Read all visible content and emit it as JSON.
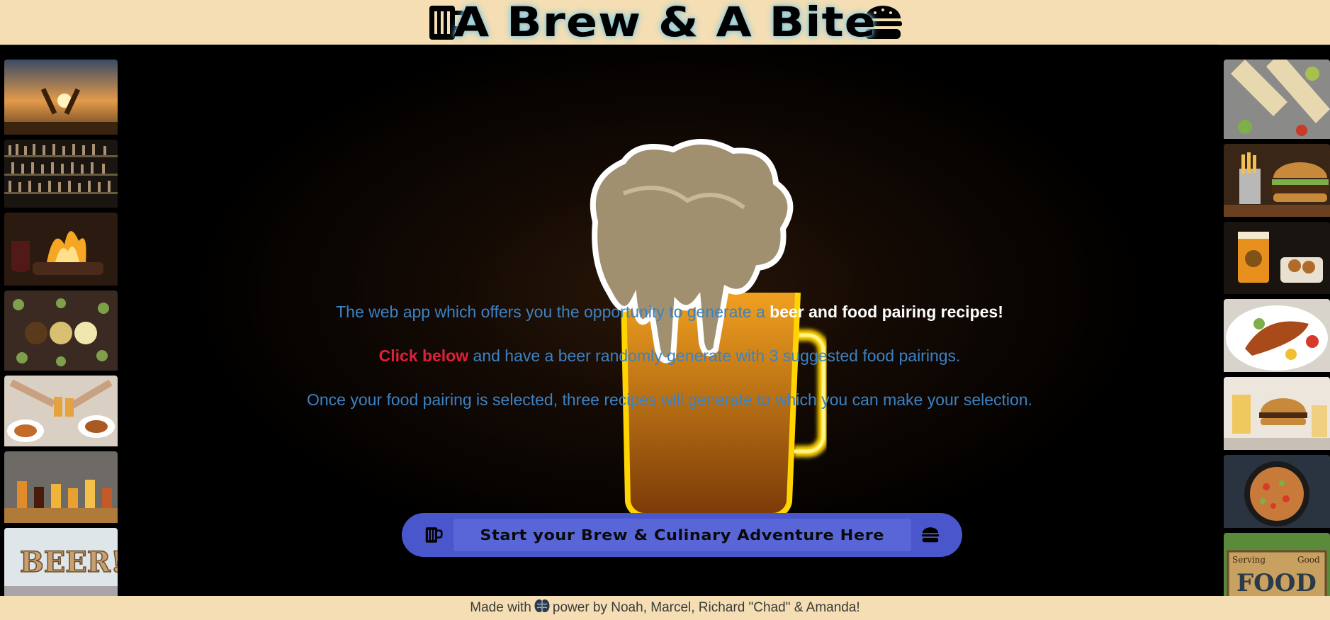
{
  "header": {
    "title": "A Brew & A Bite",
    "left_icon": "beer-mug-icon",
    "right_icon": "burger-icon"
  },
  "intro": {
    "line1_prefix": "The web app which offers you the opportunity to generate a ",
    "line1_highlight": "beer and food pairing recipes!",
    "line2_highlight": "Click below",
    "line2_suffix": " and have a beer randomly generate with 3 suggested food pairings.",
    "line3": "Once your food pairing is selected, three recipes will generate to which you can make your selection."
  },
  "cta": {
    "label": "Start your Brew & Culinary Adventure Here",
    "left_icon": "beer-mug-icon",
    "right_icon": "burger-icon"
  },
  "footer": {
    "prefix": "Made with",
    "icon": "brain-icon",
    "suffix": "power by Noah, Marcel, Richard \"Chad\" & Amanda!"
  },
  "gallery": {
    "left": [
      "beer-toast-sunset",
      "bar-bottle-shelves",
      "grilled-steak-fire",
      "hops-and-beer-glasses",
      "friends-dining-cheers",
      "beer-flight",
      "beer-sign"
    ],
    "right": [
      "wraps-platter",
      "burger-and-fries",
      "beer-and-pretzels",
      "grilled-fish-plate",
      "burger-with-beer",
      "noodle-pan",
      "serving-good-food-sign"
    ]
  },
  "colors": {
    "header_bg": "#f5deb3",
    "text_blue": "#3b82c4",
    "highlight_red": "#e0203a",
    "button_bg": "#4a56cc"
  }
}
